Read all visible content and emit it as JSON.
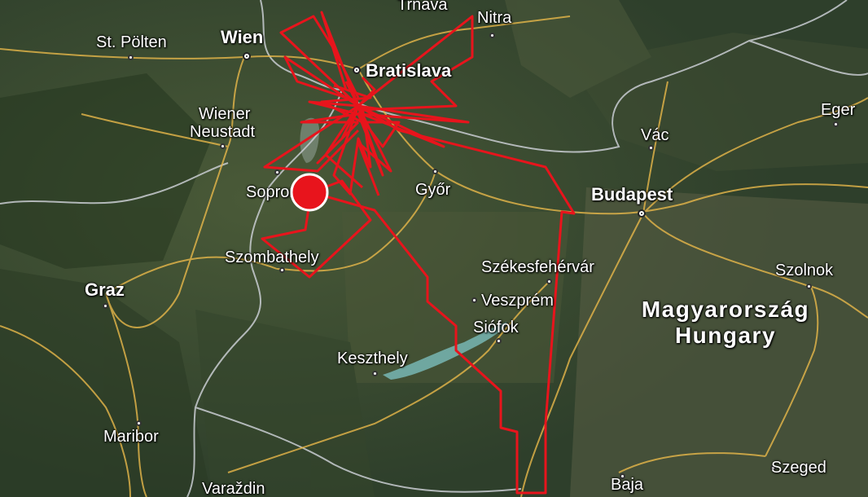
{
  "map": {
    "cities": {
      "trnava": "Trnava",
      "nitra": "Nitra",
      "st_polten": "St. Pölten",
      "wien": "Wien",
      "bratislava": "Bratislava",
      "wiener_neustadt_1": "Wiener",
      "wiener_neustadt_2": "Neustadt",
      "sopron": "Sopron",
      "gyor": "Győr",
      "vac": "Vác",
      "eger": "Eger",
      "budapest": "Budapest",
      "szombathely": "Szombathely",
      "szekesfehervar": "Székesfehérvár",
      "veszprem": "Veszprém",
      "siofok": "Siófok",
      "szolnok": "Szolnok",
      "graz": "Graz",
      "keszthely": "Keszthely",
      "maribor": "Maribor",
      "varazdin": "Varaždin",
      "baja": "Baja",
      "szeged": "Szeged"
    },
    "country": {
      "native": "Magyarország",
      "english": "Hungary"
    },
    "colors": {
      "track": "#e8141c",
      "marker": "#e8141c",
      "roads": "#e8b84a",
      "borders": "#c9cdd2",
      "lake": "#6fa7a0"
    },
    "current_position_marker": "red-location-marker"
  }
}
